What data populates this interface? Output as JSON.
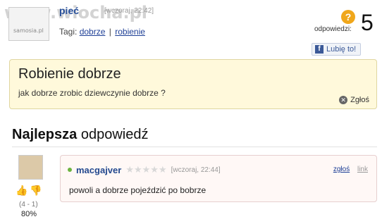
{
  "watermark": "www.wiocha.pl",
  "question": {
    "avatar_label": "samosia.pl",
    "author": "pieć",
    "date": "[wczoraj, 22:42]",
    "tags_label": "Tagi:",
    "tags": [
      "dobrze",
      "robienie"
    ],
    "tag_separator": "|",
    "answers_label": "odpowiedzi:",
    "answers_count": "5",
    "answers_icon": "?",
    "like_label": "Lubię to!",
    "title": "Robienie dobrze",
    "body": "jak dobrze zrobic dziewczynie dobrze ?",
    "report_label": "Zgłoś"
  },
  "best_answer": {
    "heading_bold": "Najlepsza",
    "heading_rest": " odpowiedź",
    "author": "macgajver",
    "stars": "★★★★★",
    "date": "[wczoraj, 22:44]",
    "report_label": "zgłoś",
    "link_label": "link",
    "body": "powoli a dobrze pojeździć po bobrze",
    "vote_score": "(4 - 1)",
    "vote_percent": "80%"
  },
  "colors": {
    "accent_link": "#1e3f96",
    "question_bg": "#fff9db",
    "answer_bg": "#fff8f6",
    "online": "#6cb33f"
  }
}
